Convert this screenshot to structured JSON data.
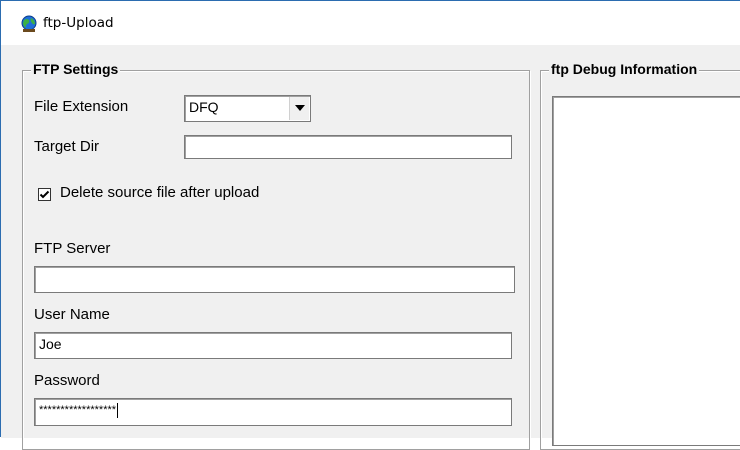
{
  "window": {
    "title": "ftp-Upload",
    "icon": "globe-app-icon"
  },
  "ftp_settings": {
    "legend": "FTP Settings",
    "file_extension": {
      "label": "File Extension",
      "value": "DFQ"
    },
    "target_dir": {
      "label": "Target Dir",
      "value": ""
    },
    "delete_source": {
      "label": "Delete source file after upload",
      "checked": true
    },
    "ftp_server": {
      "label": "FTP Server",
      "value": ""
    },
    "user_name": {
      "label": "User Name",
      "value": "Joe"
    },
    "password": {
      "label": "Password",
      "value": "******************"
    }
  },
  "debug": {
    "legend": "ftp Debug Information",
    "content": ""
  }
}
